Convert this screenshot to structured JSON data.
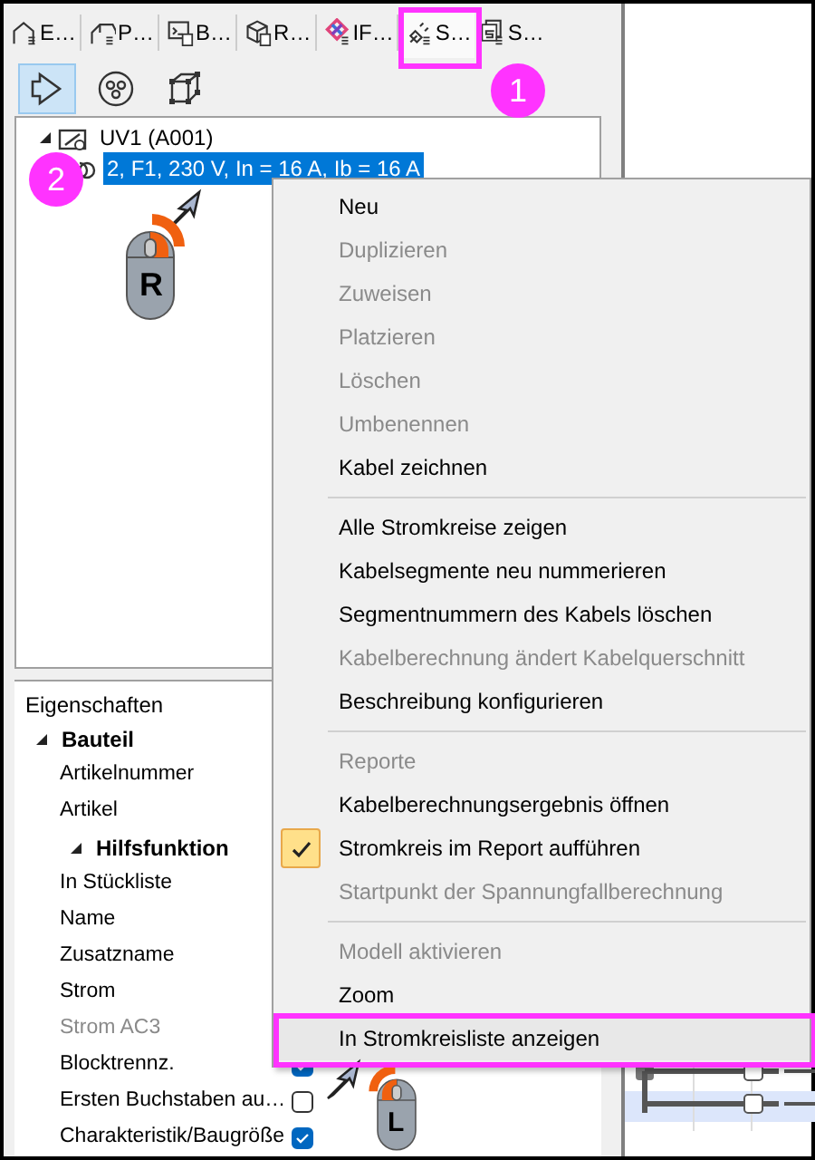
{
  "tabs": [
    {
      "label": "E…",
      "selected": false,
      "annotated": false
    },
    {
      "label": "P…",
      "selected": false,
      "annotated": false
    },
    {
      "label": "B…",
      "selected": false,
      "annotated": false
    },
    {
      "label": "R…",
      "selected": false,
      "annotated": false
    },
    {
      "label": "IF…",
      "selected": false,
      "annotated": false
    },
    {
      "label": "S…",
      "selected": true,
      "annotated": true
    },
    {
      "label": "S…",
      "selected": false,
      "annotated": false
    }
  ],
  "toolbar": [
    {
      "selected": true
    },
    {
      "selected": false
    },
    {
      "selected": false
    }
  ],
  "tree": [
    {
      "label": "UV1 (A001)",
      "expanded": true,
      "selected": false,
      "children": [
        {
          "label": "2, F1, 230 V, In = 16 A, Ib = 16 A",
          "selected": true
        }
      ]
    }
  ],
  "properties": {
    "title": "Eigenschaften",
    "rows": [
      {
        "kind": "group",
        "label": "Bauteil",
        "expanded": true,
        "children": [
          {
            "kind": "field",
            "label": "Artikelnummer",
            "disabled": false
          },
          {
            "kind": "field",
            "label": "Artikel",
            "disabled": false
          },
          {
            "kind": "group",
            "label": "Hilfsfunktion",
            "expanded": true,
            "children": [
              {
                "kind": "field",
                "label": "In Stückliste",
                "disabled": false
              },
              {
                "kind": "field",
                "label": "Name",
                "disabled": false
              },
              {
                "kind": "field",
                "label": "Zusatzname",
                "disabled": false
              },
              {
                "kind": "field",
                "label": "Strom",
                "disabled": false
              },
              {
                "kind": "field",
                "label": "Strom AC3",
                "disabled": true
              },
              {
                "kind": "checkbox",
                "label": "Blocktrennz.",
                "checked": true,
                "disabled": false
              },
              {
                "kind": "checkbox",
                "label": "Ersten Buchstaben au…",
                "checked": false,
                "disabled": false
              },
              {
                "kind": "checkbox",
                "label": "Charakteristik/Baugröße",
                "checked": true,
                "disabled": false
              }
            ]
          }
        ]
      }
    ]
  },
  "context_menu": [
    {
      "kind": "item",
      "label": "Neu",
      "disabled": false,
      "checked": false,
      "annotated": false
    },
    {
      "kind": "item",
      "label": "Duplizieren",
      "disabled": true,
      "checked": false,
      "annotated": false
    },
    {
      "kind": "item",
      "label": "Zuweisen",
      "disabled": true,
      "checked": false,
      "annotated": false
    },
    {
      "kind": "item",
      "label": "Platzieren",
      "disabled": true,
      "checked": false,
      "annotated": false
    },
    {
      "kind": "item",
      "label": "Löschen",
      "disabled": true,
      "checked": false,
      "annotated": false
    },
    {
      "kind": "item",
      "label": "Umbenennen",
      "disabled": true,
      "checked": false,
      "annotated": false
    },
    {
      "kind": "item",
      "label": "Kabel zeichnen",
      "disabled": false,
      "checked": false,
      "annotated": false
    },
    {
      "kind": "separator"
    },
    {
      "kind": "item",
      "label": "Alle Stromkreise zeigen",
      "disabled": false,
      "checked": false,
      "annotated": false
    },
    {
      "kind": "item",
      "label": "Kabelsegmente neu nummerieren",
      "disabled": false,
      "checked": false,
      "annotated": false
    },
    {
      "kind": "item",
      "label": "Segmentnummern des Kabels löschen",
      "disabled": false,
      "checked": false,
      "annotated": false
    },
    {
      "kind": "item",
      "label": "Kabelberechnung ändert Kabelquerschnitt",
      "disabled": true,
      "checked": false,
      "annotated": false
    },
    {
      "kind": "item",
      "label": "Beschreibung konfigurieren",
      "disabled": false,
      "checked": false,
      "annotated": false
    },
    {
      "kind": "separator"
    },
    {
      "kind": "item",
      "label": "Reporte",
      "disabled": true,
      "checked": false,
      "annotated": false
    },
    {
      "kind": "item",
      "label": "Kabelberechnungsergebnis öffnen",
      "disabled": false,
      "checked": false,
      "annotated": false
    },
    {
      "kind": "item",
      "label": "Stromkreis im Report aufführen",
      "disabled": false,
      "checked": true,
      "annotated": false
    },
    {
      "kind": "item",
      "label": "Startpunkt der Spannungfallberechnung",
      "disabled": true,
      "checked": false,
      "annotated": false
    },
    {
      "kind": "separator"
    },
    {
      "kind": "item",
      "label": "Modell aktivieren",
      "disabled": true,
      "checked": false,
      "annotated": false
    },
    {
      "kind": "item",
      "label": "Zoom",
      "disabled": false,
      "checked": false,
      "annotated": false
    },
    {
      "kind": "item",
      "label": "In Stromkreisliste anzeigen",
      "disabled": false,
      "checked": false,
      "annotated": true
    }
  ],
  "step_badges": [
    {
      "label": "1"
    },
    {
      "label": "2"
    }
  ],
  "mouse_hints": [
    {
      "button": "R",
      "left_pressed": false,
      "right_pressed": true
    },
    {
      "button": "L",
      "left_pressed": true,
      "right_pressed": false
    }
  ]
}
